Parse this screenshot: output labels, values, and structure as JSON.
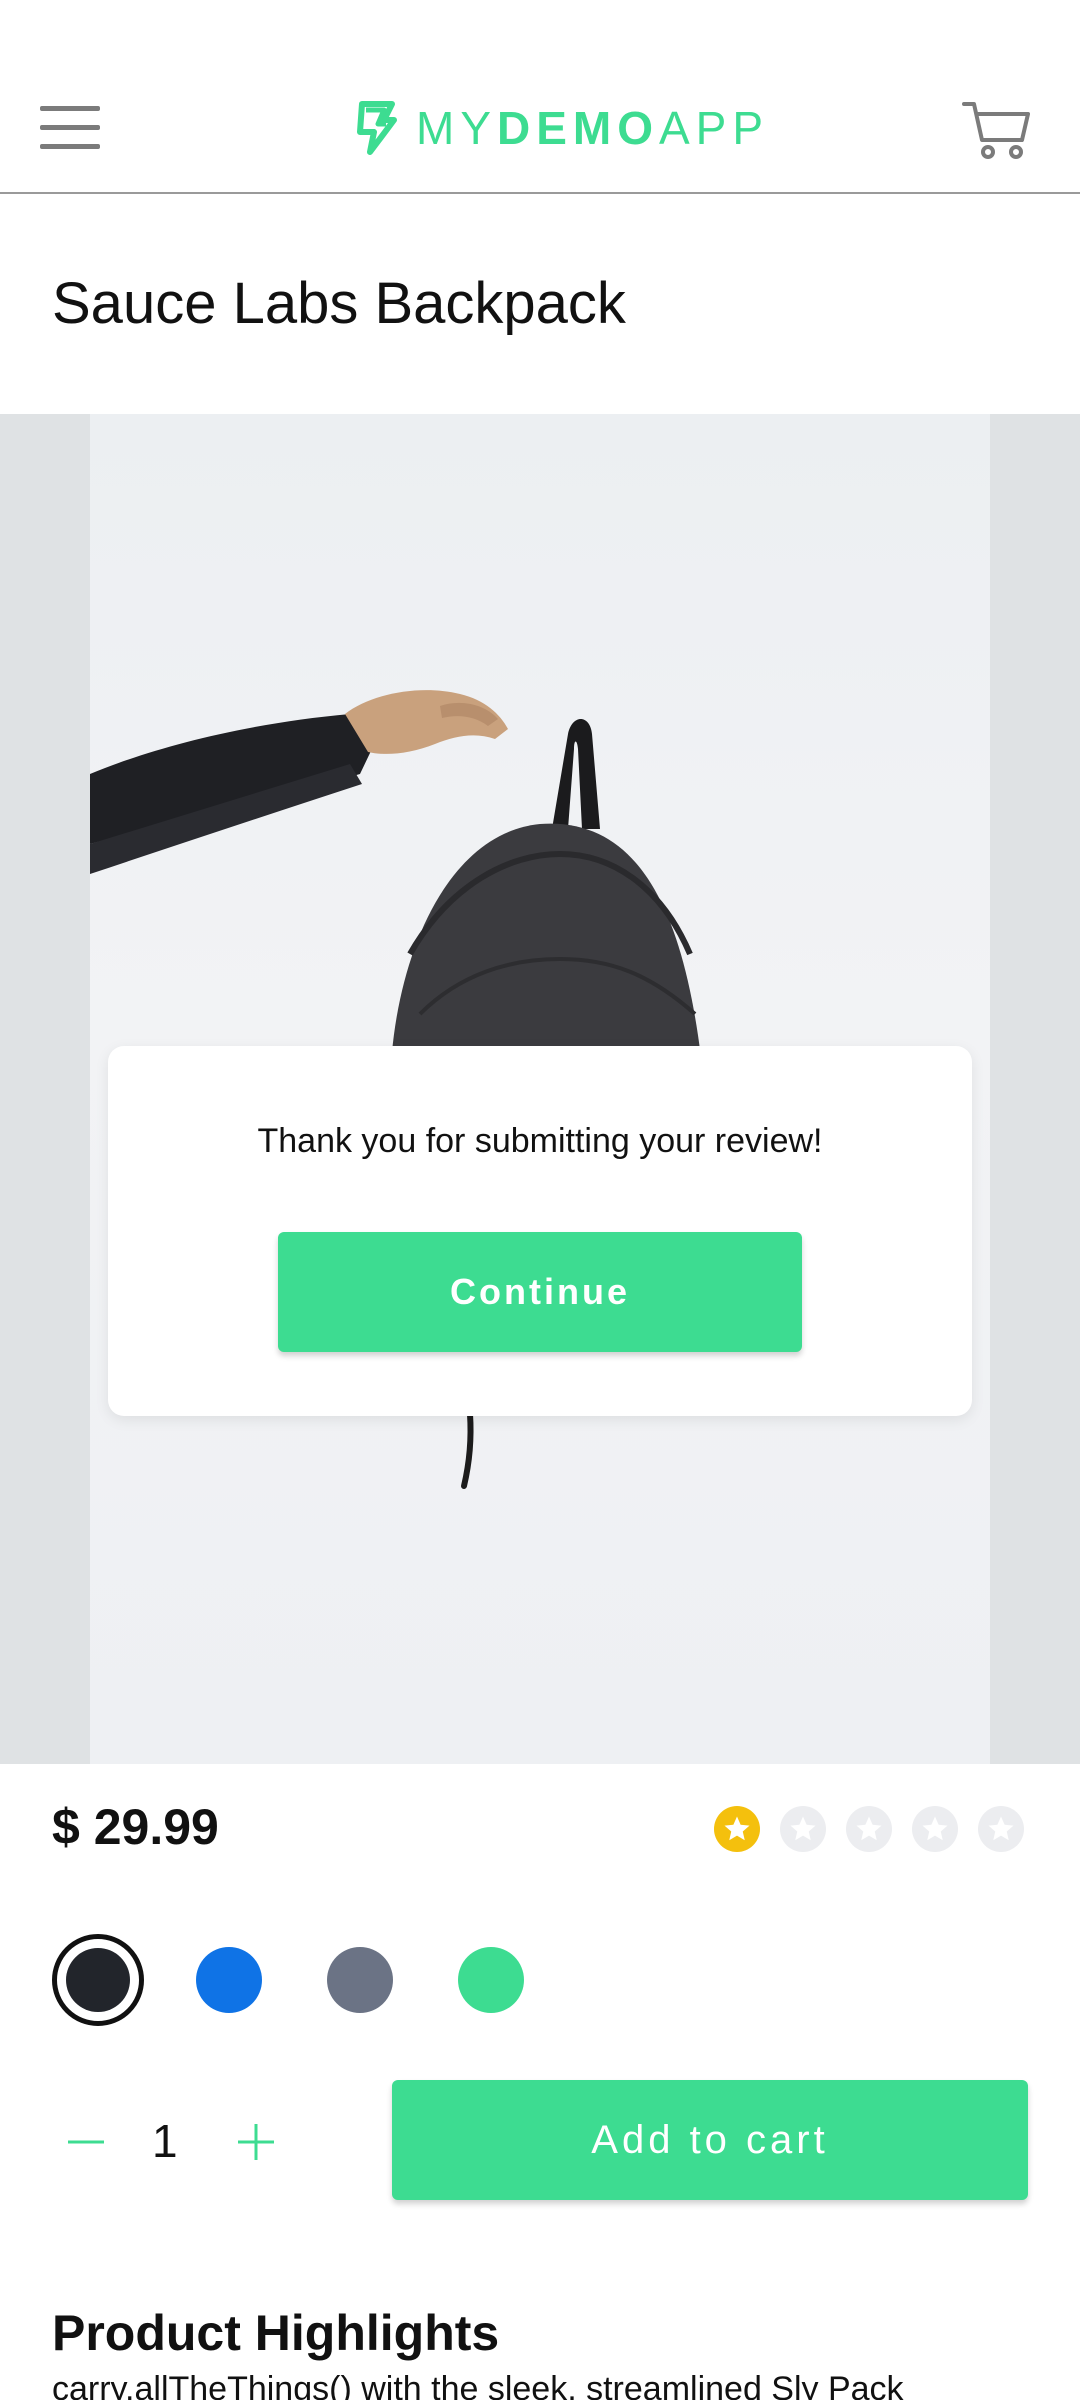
{
  "header": {
    "logo_text_light_1": "MY",
    "logo_text_bold": "DEMO",
    "logo_text_light_2": "APP"
  },
  "product": {
    "title": "Sauce Labs Backpack",
    "price": "$ 29.99",
    "rating": {
      "value": 1,
      "max": 5
    },
    "colors": [
      {
        "name": "black",
        "hex": "#22252b",
        "selected": true
      },
      {
        "name": "blue",
        "hex": "#0f73e6",
        "selected": false
      },
      {
        "name": "gray",
        "hex": "#6b7385",
        "selected": false
      },
      {
        "name": "green",
        "hex": "#3ddc91",
        "selected": false
      }
    ],
    "quantity": "1",
    "add_to_cart_label": "Add to cart",
    "highlights_title": "Product Highlights",
    "highlights_text": "carry.allTheThings() with the sleek, streamlined Sly Pack"
  },
  "modal": {
    "message": "Thank you for submitting your review!",
    "continue_label": "Continue"
  },
  "theme": {
    "accent": "#3ddc91",
    "star_filled": "#f4c00d",
    "star_empty": "#ecedf0"
  },
  "icons": [
    "menu-icon",
    "logo-icon",
    "cart-icon",
    "star-icon",
    "minus-icon",
    "plus-icon"
  ]
}
